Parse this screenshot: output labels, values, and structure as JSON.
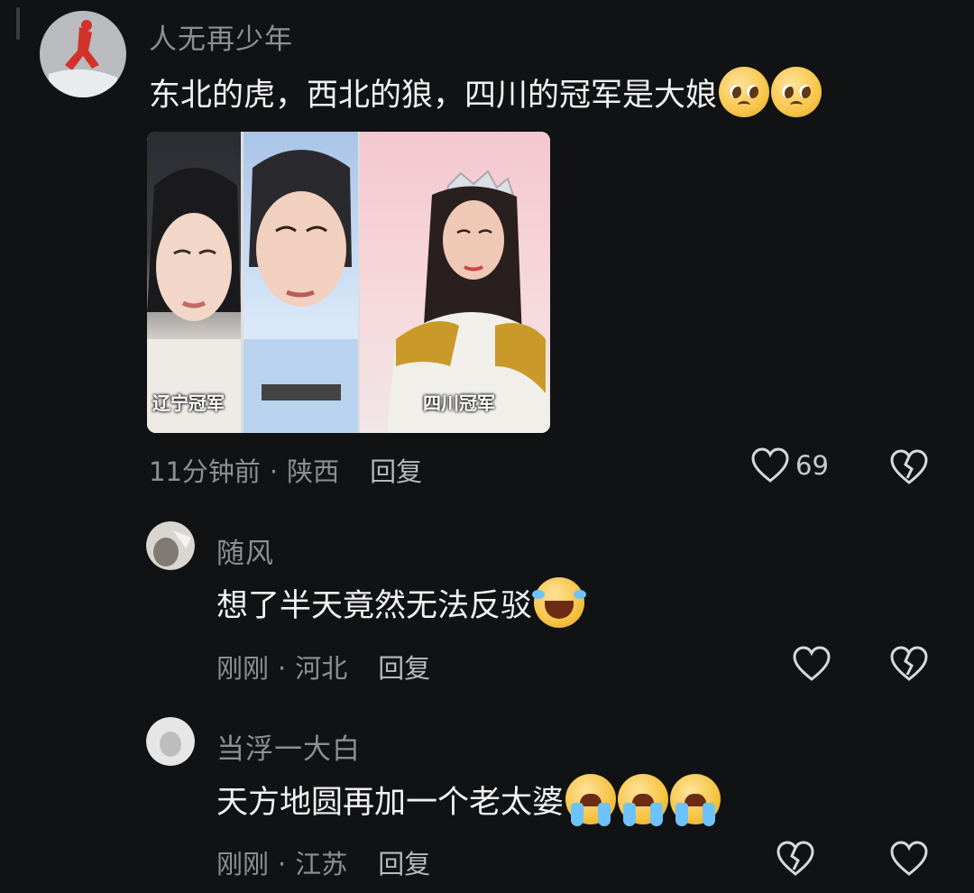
{
  "comments": [
    {
      "username": "人无再少年",
      "text": "东北的虎，西北的狼，四川的冠军是大娘",
      "emojis": [
        "pleading-face-icon",
        "pleading-face-icon"
      ],
      "time": "11分钟前",
      "region": "陕西",
      "reply_label": "回复",
      "likes": "69",
      "image": {
        "panels": [
          {
            "caption": "辽宁冠军"
          },
          {
            "caption": ""
          },
          {
            "caption": "四川冠军"
          }
        ]
      }
    },
    {
      "username": "随风",
      "text": "想了半天竟然无法反驳",
      "emojis": [
        "laughing-crying-face-icon"
      ],
      "time": "刚刚",
      "region": "河北",
      "reply_label": "回复"
    },
    {
      "username": "当浮一大白",
      "text": "天方地圆再加一个老太婆",
      "emojis": [
        "loudly-crying-face-icon",
        "loudly-crying-face-icon",
        "loudly-crying-face-icon"
      ],
      "time": "刚刚",
      "region": "江苏",
      "reply_label": "回复"
    }
  ],
  "separator": "·",
  "colors": {
    "background": "#111214",
    "text": "#f2f2f3",
    "muted": "#8e8f94"
  }
}
